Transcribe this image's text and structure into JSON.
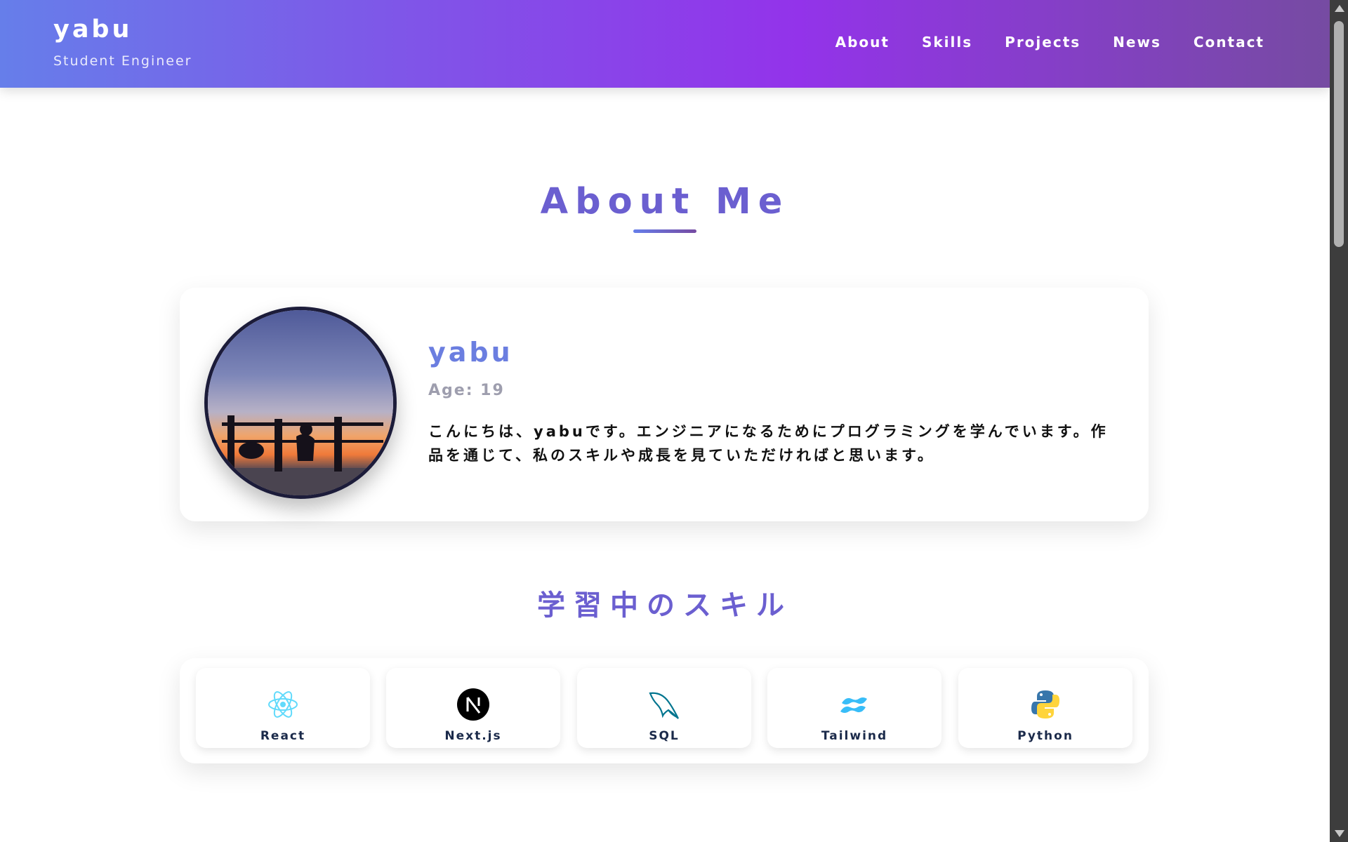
{
  "header": {
    "brand": "yabu",
    "subtitle": "Student Engineer",
    "nav": [
      "About",
      "Skills",
      "Projects",
      "News",
      "Contact"
    ]
  },
  "about": {
    "title": "About Me",
    "name": "yabu",
    "age": "Age: 19",
    "bio": "こんにちは、yabuです。エンジニアになるためにプログラミングを学んでいます。作品を通じて、私のスキルや成長を見ていただければと思います。"
  },
  "skills": {
    "title": "学習中のスキル",
    "items": [
      {
        "label": "React",
        "icon": "react-icon"
      },
      {
        "label": "Next.js",
        "icon": "nextjs-icon"
      },
      {
        "label": "SQL",
        "icon": "sql-icon"
      },
      {
        "label": "Tailwind",
        "icon": "tailwind-icon"
      },
      {
        "label": "Python",
        "icon": "python-icon"
      }
    ]
  },
  "colors": {
    "header_gradient": [
      "#667eea",
      "#9333ea",
      "#764ba2"
    ],
    "accent": "#6b5fd0"
  }
}
